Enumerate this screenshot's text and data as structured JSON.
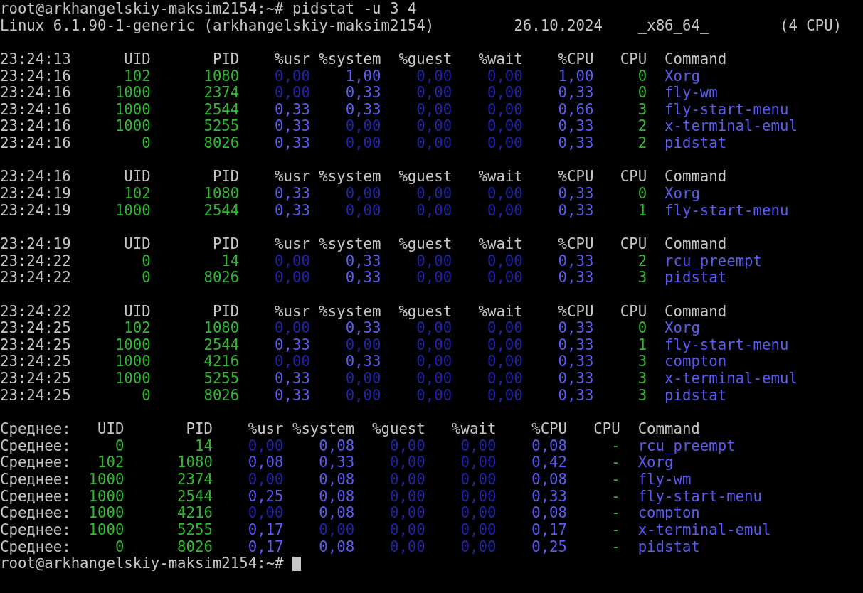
{
  "command_line": {
    "prompt": "root@arkhangelskiy-maksim2154:~#",
    "command": "pidstat -u 3 4"
  },
  "system_info": {
    "kernel": "Linux 6.1.90-1-generic (arkhangelskiy-maksim2154)",
    "date": "26.10.2024",
    "arch": "_x86_64_",
    "cpus": "(4 CPU)"
  },
  "samples": [
    {
      "header": [
        "23:24:13",
        "UID",
        "PID",
        "%usr",
        "%system",
        "%guest",
        "%wait",
        "%CPU",
        "CPU",
        "Command"
      ],
      "rows": [
        [
          "23:24:16",
          "102",
          "1080",
          "0,00",
          "1,00",
          "0,00",
          "0,00",
          "1,00",
          "0",
          "Xorg"
        ],
        [
          "23:24:16",
          "1000",
          "2374",
          "0,00",
          "0,33",
          "0,00",
          "0,00",
          "0,33",
          "0",
          "fly-wm"
        ],
        [
          "23:24:16",
          "1000",
          "2544",
          "0,33",
          "0,33",
          "0,00",
          "0,00",
          "0,66",
          "3",
          "fly-start-menu"
        ],
        [
          "23:24:16",
          "1000",
          "5255",
          "0,33",
          "0,00",
          "0,00",
          "0,00",
          "0,33",
          "2",
          "x-terminal-emul"
        ],
        [
          "23:24:16",
          "0",
          "8026",
          "0,33",
          "0,00",
          "0,00",
          "0,00",
          "0,33",
          "2",
          "pidstat"
        ]
      ]
    },
    {
      "header": [
        "23:24:16",
        "UID",
        "PID",
        "%usr",
        "%system",
        "%guest",
        "%wait",
        "%CPU",
        "CPU",
        "Command"
      ],
      "rows": [
        [
          "23:24:19",
          "102",
          "1080",
          "0,33",
          "0,00",
          "0,00",
          "0,00",
          "0,33",
          "0",
          "Xorg"
        ],
        [
          "23:24:19",
          "1000",
          "2544",
          "0,33",
          "0,00",
          "0,00",
          "0,00",
          "0,33",
          "1",
          "fly-start-menu"
        ]
      ]
    },
    {
      "header": [
        "23:24:19",
        "UID",
        "PID",
        "%usr",
        "%system",
        "%guest",
        "%wait",
        "%CPU",
        "CPU",
        "Command"
      ],
      "rows": [
        [
          "23:24:22",
          "0",
          "14",
          "0,00",
          "0,33",
          "0,00",
          "0,00",
          "0,33",
          "2",
          "rcu_preempt"
        ],
        [
          "23:24:22",
          "0",
          "8026",
          "0,00",
          "0,33",
          "0,00",
          "0,00",
          "0,33",
          "3",
          "pidstat"
        ]
      ]
    },
    {
      "header": [
        "23:24:22",
        "UID",
        "PID",
        "%usr",
        "%system",
        "%guest",
        "%wait",
        "%CPU",
        "CPU",
        "Command"
      ],
      "rows": [
        [
          "23:24:25",
          "102",
          "1080",
          "0,00",
          "0,33",
          "0,00",
          "0,00",
          "0,33",
          "0",
          "Xorg"
        ],
        [
          "23:24:25",
          "1000",
          "2544",
          "0,33",
          "0,00",
          "0,00",
          "0,00",
          "0,33",
          "1",
          "fly-start-menu"
        ],
        [
          "23:24:25",
          "1000",
          "4216",
          "0,00",
          "0,33",
          "0,00",
          "0,00",
          "0,33",
          "3",
          "compton"
        ],
        [
          "23:24:25",
          "1000",
          "5255",
          "0,33",
          "0,00",
          "0,00",
          "0,00",
          "0,33",
          "3",
          "x-terminal-emul"
        ],
        [
          "23:24:25",
          "0",
          "8026",
          "0,33",
          "0,00",
          "0,00",
          "0,00",
          "0,33",
          "3",
          "pidstat"
        ]
      ]
    }
  ],
  "average": {
    "header": [
      "Среднее:",
      "UID",
      "PID",
      "%usr",
      "%system",
      "%guest",
      "%wait",
      "%CPU",
      "CPU",
      "Command"
    ],
    "rows": [
      [
        "Среднее:",
        "0",
        "14",
        "0,00",
        "0,08",
        "0,00",
        "0,00",
        "0,08",
        "-",
        "rcu_preempt"
      ],
      [
        "Среднее:",
        "102",
        "1080",
        "0,08",
        "0,33",
        "0,00",
        "0,00",
        "0,42",
        "-",
        "Xorg"
      ],
      [
        "Среднее:",
        "1000",
        "2374",
        "0,00",
        "0,08",
        "0,00",
        "0,00",
        "0,08",
        "-",
        "fly-wm"
      ],
      [
        "Среднее:",
        "1000",
        "2544",
        "0,25",
        "0,08",
        "0,00",
        "0,00",
        "0,33",
        "-",
        "fly-start-menu"
      ],
      [
        "Среднее:",
        "1000",
        "4216",
        "0,00",
        "0,08",
        "0,00",
        "0,00",
        "0,08",
        "-",
        "compton"
      ],
      [
        "Среднее:",
        "1000",
        "5255",
        "0,17",
        "0,00",
        "0,00",
        "0,00",
        "0,17",
        "-",
        "x-terminal-emul"
      ],
      [
        "Среднее:",
        "0",
        "8026",
        "0,17",
        "0,08",
        "0,00",
        "0,00",
        "0,25",
        "-",
        "pidstat"
      ]
    ]
  },
  "prompt": {
    "text": "root@arkhangelskiy-maksim2154:~#",
    "cursor": true
  }
}
